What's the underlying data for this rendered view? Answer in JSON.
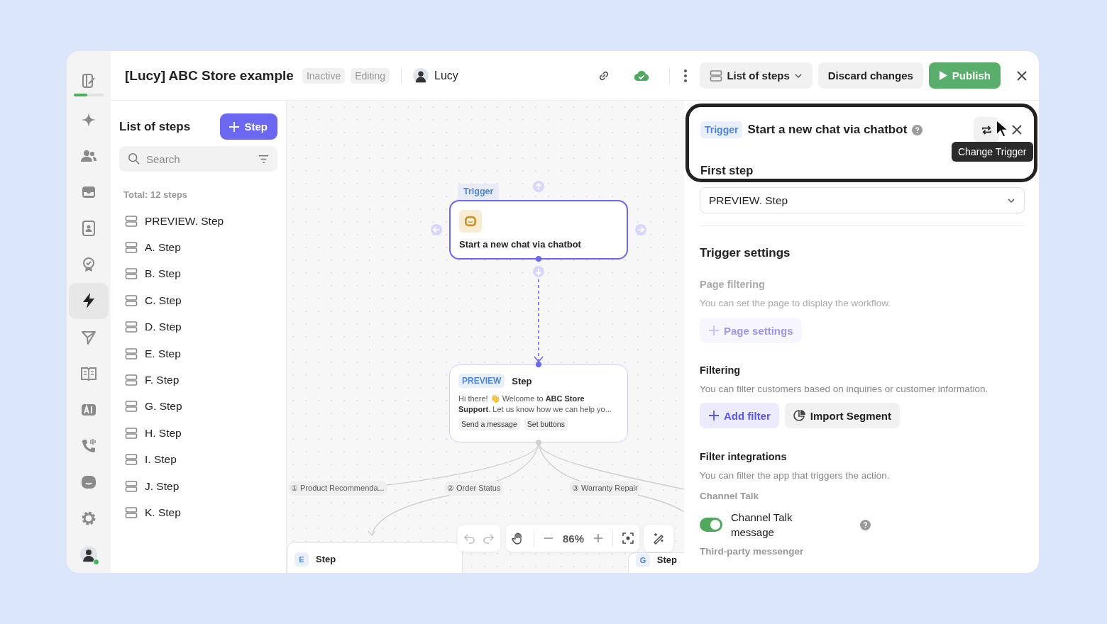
{
  "rail": {
    "progress": {
      "level": 0.45
    },
    "items": [
      {
        "kind": "editor",
        "selected": false
      },
      {
        "kind": "sparkle",
        "selected": false
      },
      {
        "kind": "people",
        "selected": false
      },
      {
        "kind": "inbox",
        "selected": false
      },
      {
        "kind": "contact",
        "selected": false
      },
      {
        "kind": "badge",
        "selected": false
      },
      {
        "kind": "bolt",
        "selected": true
      },
      {
        "kind": "send",
        "selected": false
      },
      {
        "kind": "book",
        "selected": false
      },
      {
        "kind": "ai",
        "selected": false
      },
      {
        "kind": "phone",
        "selected": false
      },
      {
        "kind": "chat",
        "selected": false
      },
      {
        "kind": "gear",
        "selected": false
      },
      {
        "kind": "avatar",
        "selected": false
      }
    ]
  },
  "header": {
    "title": "[Lucy] ABC Store example",
    "badges": [
      "Inactive",
      "Editing"
    ],
    "user": "Lucy",
    "steps_menu": "List of steps",
    "discard": "Discard changes",
    "publish": "Publish"
  },
  "steps_panel": {
    "title": "List of steps",
    "add_button": "Step",
    "search": {
      "placeholder": "Search"
    },
    "total": "Total: 12 steps",
    "steps": [
      "PREVIEW. Step",
      "A. Step",
      "B. Step",
      "C. Step",
      "D. Step",
      "E. Step",
      "F. Step",
      "G. Step",
      "H. Step",
      "I. Step",
      "J. Step",
      "K. Step"
    ]
  },
  "canvas": {
    "trigger_node": {
      "tag": "Trigger",
      "title": "Start a new chat via chatbot"
    },
    "preview_node": {
      "tag": "PREVIEW",
      "title": "Step",
      "message": "Hi there! 👋 Welcome to **ABC Store Support**. Let us know how we can help yo...",
      "chips": [
        "Send a message",
        "Set buttons"
      ]
    },
    "branches": [
      "① Product Recommenda...",
      "② Order Status",
      "③ Warranty Repair"
    ],
    "bottom_nodes": [
      {
        "letter": "E",
        "title": "Step"
      },
      {
        "letter": "G",
        "title": "Step"
      }
    ],
    "zoom": "86%"
  },
  "panel": {
    "trigger_tag": "Trigger",
    "title": "Start a new chat via chatbot",
    "tooltip": "Change Trigger",
    "first_step": {
      "label": "First step",
      "value": "PREVIEW. Step"
    },
    "settings_title": "Trigger settings",
    "page_filtering": {
      "title": "Page filtering",
      "description": "You can set the page to display the workflow.",
      "button": "Page settings",
      "disabled": true
    },
    "filtering": {
      "title": "Filtering",
      "description": "You can filter customers based on inquiries or customer information.",
      "add_button": "Add filter",
      "import_button": "Import Segment"
    },
    "integrations": {
      "title": "Filter integrations",
      "description": "You can filter the app that triggers the action.",
      "group": "Channel Talk",
      "toggle": {
        "label": "Channel Talk message",
        "on": true
      },
      "next_group": "Third-party messenger"
    }
  }
}
